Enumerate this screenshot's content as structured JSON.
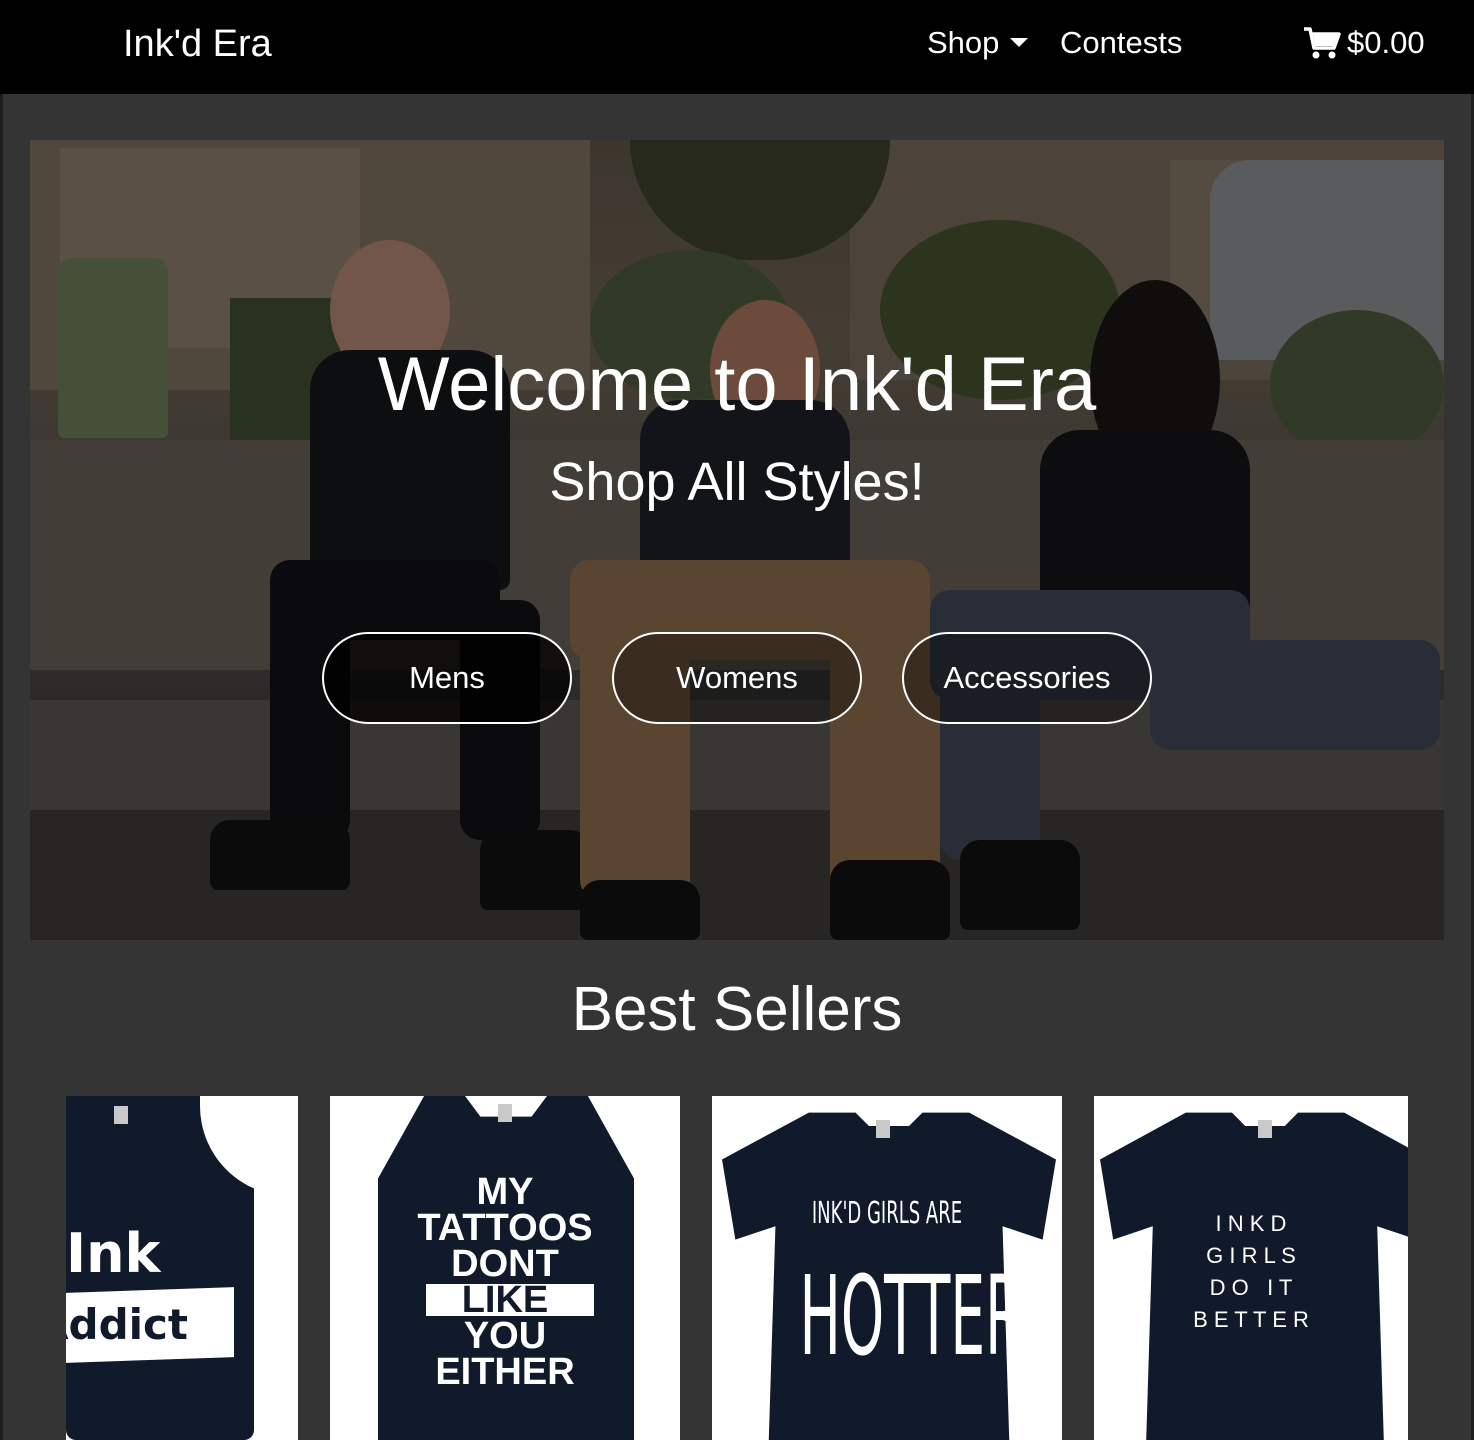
{
  "nav": {
    "brand": "Ink'd Era",
    "shop_label": "Shop",
    "contests_label": "Contests",
    "cart_total": "$0.00"
  },
  "hero": {
    "title": "Welcome to Ink'd Era",
    "subtitle": "Shop All Styles!",
    "buttons": [
      {
        "label": "Mens"
      },
      {
        "label": "Womens"
      },
      {
        "label": "Accessories"
      }
    ]
  },
  "best_sellers": {
    "title": "Best Sellers",
    "products": [
      {
        "print_lines": [
          "Ink",
          "Addict"
        ]
      },
      {
        "print_lines": [
          "MY",
          "TATTOOS",
          "DONT",
          "LIKE",
          "YOU",
          "EITHER"
        ]
      },
      {
        "print_lines": [
          "INK'D GIRLS ARE",
          "HOTTER"
        ]
      },
      {
        "print_lines": [
          "I N K D",
          "G I R L S",
          "D O   I T",
          "B E T T E R"
        ]
      }
    ]
  },
  "colors": {
    "navbar_bg": "#000000",
    "page_bg": "#343434",
    "garment": "#111a2b"
  },
  "icons": [
    "cart-icon",
    "chevron-down-icon"
  ]
}
